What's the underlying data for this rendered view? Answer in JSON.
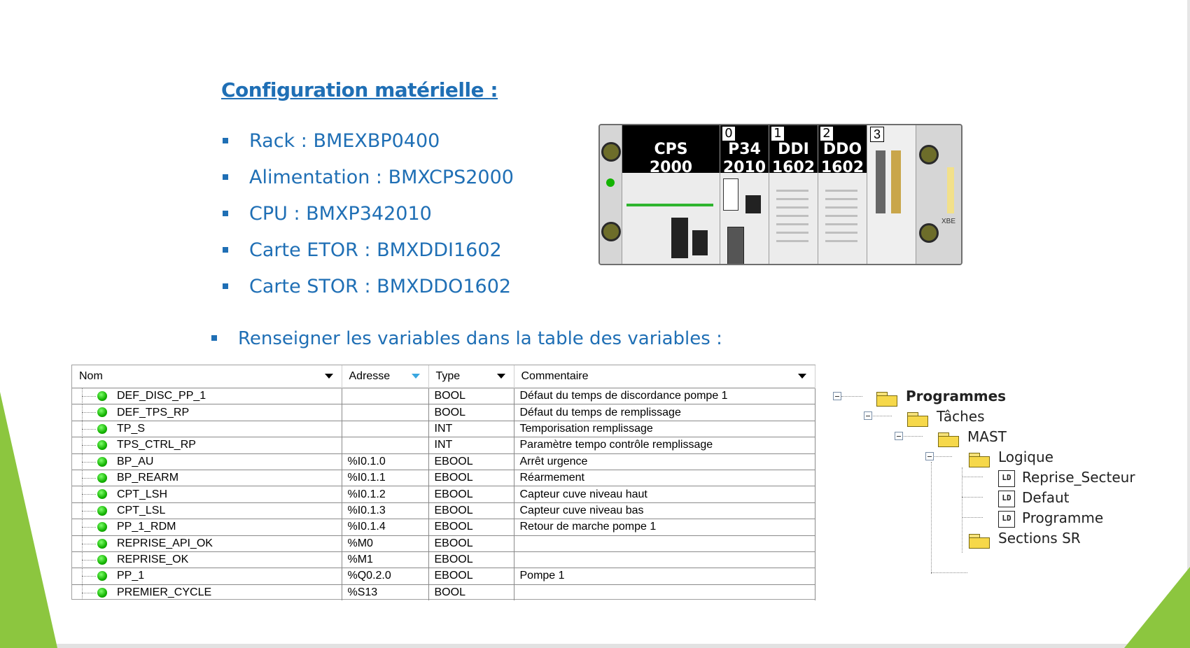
{
  "colors": {
    "accent": "#1f6fb5",
    "green_decor": "#8cc63f",
    "led": "#13b300"
  },
  "title": "Configuration matérielle :",
  "hardware_items": [
    "Rack : BMEXBP0400",
    "Alimentation : BMXCPS2000",
    "CPU : BMXP342010",
    "Carte ETOR : BMXDDI1602",
    "Carte STOR : BMXDDO1602"
  ],
  "instruction": "Renseigner les variables dans la table des variables :",
  "rack": {
    "cps": {
      "line1": "CPS",
      "line2": "2000"
    },
    "cpu": {
      "slot": "0",
      "line1": "P34",
      "line2": "2010"
    },
    "ddi": {
      "slot": "1",
      "line1": "DDI",
      "line2": "1602"
    },
    "ddo": {
      "slot": "2",
      "line1": "DDO",
      "line2": "1602"
    },
    "slot3": "3",
    "xbe": "XBE"
  },
  "table": {
    "headers": {
      "nom": "Nom",
      "adresse": "Adresse",
      "type": "Type",
      "commentaire": "Commentaire"
    },
    "rows": [
      {
        "nom": "DEF_DISC_PP_1",
        "adresse": "",
        "type": "BOOL",
        "commentaire": "Défaut du temps de discordance pompe 1"
      },
      {
        "nom": "DEF_TPS_RP",
        "adresse": "",
        "type": "BOOL",
        "commentaire": "Défaut du temps de remplissage"
      },
      {
        "nom": "TP_S",
        "adresse": "",
        "type": "INT",
        "commentaire": "Temporisation remplissage"
      },
      {
        "nom": "TPS_CTRL_RP",
        "adresse": "",
        "type": "INT",
        "commentaire": "Paramètre tempo contrôle remplissage"
      },
      {
        "nom": "BP_AU",
        "adresse": "%I0.1.0",
        "type": "EBOOL",
        "commentaire": "Arrêt urgence"
      },
      {
        "nom": "BP_REARM",
        "adresse": "%I0.1.1",
        "type": "EBOOL",
        "commentaire": "Réarmement"
      },
      {
        "nom": "CPT_LSH",
        "adresse": "%I0.1.2",
        "type": "EBOOL",
        "commentaire": "Capteur cuve niveau haut"
      },
      {
        "nom": "CPT_LSL",
        "adresse": "%I0.1.3",
        "type": "EBOOL",
        "commentaire": "Capteur cuve niveau bas"
      },
      {
        "nom": "PP_1_RDM",
        "adresse": "%I0.1.4",
        "type": "EBOOL",
        "commentaire": "Retour de marche pompe 1"
      },
      {
        "nom": "REPRISE_API_OK",
        "adresse": "%M0",
        "type": "EBOOL",
        "commentaire": ""
      },
      {
        "nom": "REPRISE_OK",
        "adresse": "%M1",
        "type": "EBOOL",
        "commentaire": ""
      },
      {
        "nom": "PP_1",
        "adresse": "%Q0.2.0",
        "type": "EBOOL",
        "commentaire": "Pompe 1"
      },
      {
        "nom": "PREMIER_CYCLE",
        "adresse": "%S13",
        "type": "BOOL",
        "commentaire": ""
      }
    ]
  },
  "project_tree": {
    "programmes": "Programmes",
    "taches": "Tâches",
    "mast": "MAST",
    "logique": "Logique",
    "sections": [
      "Reprise_Secteur",
      "Defaut",
      "Programme"
    ],
    "section_icon": "LD",
    "sections_sr": "Sections SR"
  }
}
